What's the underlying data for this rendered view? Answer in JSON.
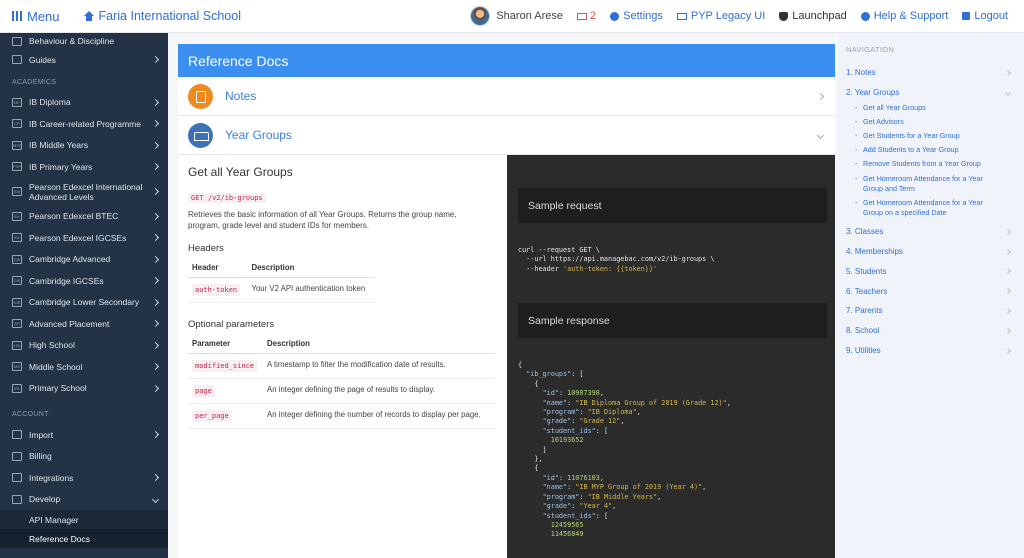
{
  "topbar": {
    "menu_label": "Menu",
    "school_name": "Faria International School",
    "user_name": "Sharon Arese",
    "mail_count": "2",
    "settings": "Settings",
    "pyp": "PYP Legacy UI",
    "launchpad": "Launchpad",
    "help": "Help & Support",
    "logout": "Logout"
  },
  "sidebar": {
    "top_items": [
      {
        "label": "Behaviour & Discipline",
        "icon": "flag-icon"
      },
      {
        "label": "Guides",
        "icon": "map-icon"
      }
    ],
    "academics_heading": "ACADEMICS",
    "academics": [
      {
        "label": "IB Diploma",
        "icon": "DP"
      },
      {
        "label": "IB Career-related Programme",
        "icon": "CP"
      },
      {
        "label": "IB Middle Years",
        "icon": "MYP"
      },
      {
        "label": "IB Primary Years",
        "icon": "PYP"
      },
      {
        "label": "Pearson Edexcel International Advanced Levels",
        "icon": "EdI"
      },
      {
        "label": "Pearson Edexcel BTEC",
        "icon": "Ed"
      },
      {
        "label": "Pearson Edexcel IGCSEs",
        "icon": "Ed"
      },
      {
        "label": "Cambridge Advanced",
        "icon": "CIE"
      },
      {
        "label": "Cambridge IGCSEs",
        "icon": "CIE"
      },
      {
        "label": "Cambridge Lower Secondary",
        "icon": "CIE"
      },
      {
        "label": "Advanced Placement",
        "icon": "AP"
      },
      {
        "label": "High School",
        "icon": "HS"
      },
      {
        "label": "Middle School",
        "icon": "MS"
      },
      {
        "label": "Primary School",
        "icon": "PS"
      }
    ],
    "account_heading": "ACCOUNT",
    "account": [
      {
        "label": "Import"
      },
      {
        "label": "Billing"
      },
      {
        "label": "Integrations"
      },
      {
        "label": "Develop"
      }
    ],
    "develop_sub": [
      "API Manager",
      "Reference Docs"
    ]
  },
  "main": {
    "header": "Reference Docs",
    "sections": [
      "Notes",
      "Year Groups"
    ],
    "doc": {
      "title": "Get all Year Groups",
      "endpoint": "GET /v2/ib-groups",
      "description": "Retrieves the basic information of all Year Groups. Returns the group name, program, grade level and student IDs for members.",
      "headers_title": "Headers",
      "headers_cols": [
        "Header",
        "Description"
      ],
      "headers_rows": [
        {
          "name": "auth-token",
          "desc": "Your V2 API authentication token"
        }
      ],
      "params_title": "Optional parameters",
      "params_cols": [
        "Parameter",
        "Description"
      ],
      "params_rows": [
        {
          "name": "modified_since",
          "desc": "A timestamp to filter the modification date of results."
        },
        {
          "name": "page",
          "desc": "An integer defining the page of results to display."
        },
        {
          "name": "per_page",
          "desc": "An integer defining the number of records to display per page."
        }
      ]
    },
    "code": {
      "request_title": "Sample request",
      "request_lines": [
        "curl --request GET \\",
        "  --url https://api.managebac.com/v2/ib-groups \\",
        "  --header 'auth-token: {{token}}'"
      ],
      "response_title": "Sample response",
      "response_lines": [
        "{",
        "  \"ib_groups\": [",
        "    {",
        "      \"id\": 10907398,",
        "      \"name\": \"IB Diploma Group of 2019 (Grade 12)\",",
        "      \"program\": \"IB Diploma\",",
        "      \"grade\": \"Grade 12\",",
        "      \"student_ids\": [",
        "        10193652",
        "      ]",
        "    },",
        "    {",
        "      \"id\": 11076103,",
        "      \"name\": \"IB MYP Group of 2019 (Year 4)\",",
        "      \"program\": \"IB Middle Years\",",
        "      \"grade\": \"Year 4\",",
        "      \"student_ids\": [",
        "        12459565",
        "        11456849"
      ]
    }
  },
  "rnav": {
    "heading": "NAVIGATION",
    "items": [
      {
        "label": "1. Notes"
      },
      {
        "label": "2. Year Groups",
        "expanded": true
      },
      {
        "label": "3. Classes"
      },
      {
        "label": "4. Memberships"
      },
      {
        "label": "5. Students"
      },
      {
        "label": "6. Teachers"
      },
      {
        "label": "7. Parents"
      },
      {
        "label": "8. School"
      },
      {
        "label": "9. Utilities"
      }
    ],
    "year_group_subs": [
      "Get all Year Groups",
      "Get Advisors",
      "Get Students for a Year Group",
      "Add Students to a Year Group",
      "Remove Students from a Year Group",
      "Get Homeroom Attendance for a Year Group and Term",
      "Get Homeroom Attendance for a Year Group on a specified Date"
    ]
  }
}
